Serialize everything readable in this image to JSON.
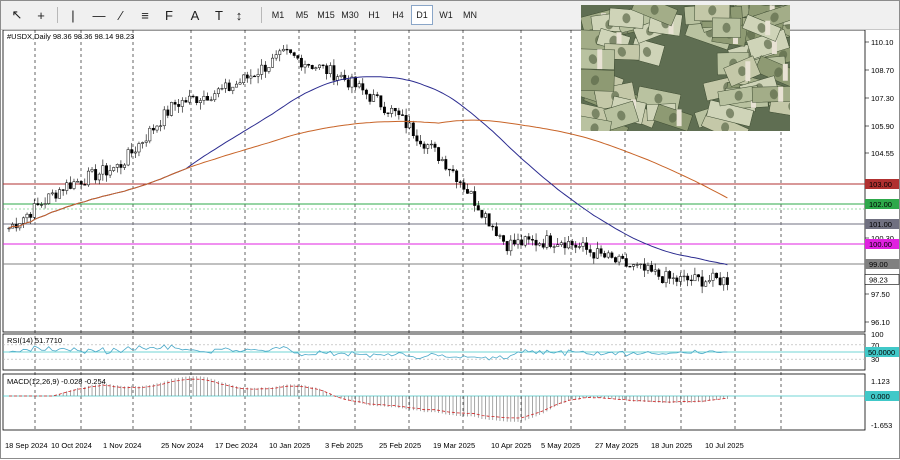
{
  "toolbar": {
    "tools": [
      {
        "name": "cursor-icon",
        "glyph": "↖"
      },
      {
        "name": "crosshair-icon",
        "glyph": "+"
      },
      {
        "name": "vertical-line-icon",
        "glyph": "|"
      },
      {
        "name": "horizontal-line-icon",
        "glyph": "—"
      },
      {
        "name": "trendline-icon",
        "glyph": "∕"
      },
      {
        "name": "equidistant-channel-icon",
        "glyph": "≡"
      },
      {
        "name": "fibonacci-icon",
        "glyph": "F"
      },
      {
        "name": "text-icon",
        "glyph": "A"
      },
      {
        "name": "text-label-icon",
        "glyph": "T"
      },
      {
        "name": "arrows-icon",
        "glyph": "↕"
      }
    ],
    "timeframes": [
      "M1",
      "M5",
      "M15",
      "M30",
      "H1",
      "H4",
      "D1",
      "W1",
      "MN"
    ],
    "active_timeframe": "D1"
  },
  "header": {
    "symbol_line": "#USDX,Daily  98.36 98.36 98.14 98.23"
  },
  "price_axis": {
    "ticks": [
      "110.10",
      "108.70",
      "107.30",
      "105.90",
      "104.55",
      "103.00",
      "102.00",
      "101.00",
      "100.30",
      "100.00",
      "99.00",
      "98.23",
      "97.50",
      "96.10"
    ]
  },
  "levels": [
    {
      "label": "103.00",
      "price": 103.0,
      "color": "#b03030"
    },
    {
      "label": "102.00",
      "price": 102.0,
      "color": "#2ea84a"
    },
    {
      "label": "101.00",
      "price": 101.0,
      "color": "#707080"
    },
    {
      "label": "100.00",
      "price": 100.0,
      "color": "#e020e0"
    },
    {
      "label": "99.00",
      "price": 99.0,
      "color": "#808080"
    }
  ],
  "current_price": "98.23",
  "rsi": {
    "label": "RSI(14) 51.7710",
    "ticks": [
      "100",
      "70",
      "50.0000",
      "30",
      "0"
    ]
  },
  "macd": {
    "label": "MACD(12,26,9) -0.028 -0.254",
    "ticks": [
      "1.123",
      "0.000",
      "-1.653"
    ]
  },
  "date_axis": [
    "18 Sep 2024",
    "10 Oct 2024",
    "1 Nov 2024",
    "25 Nov 2024",
    "17 Dec 2024",
    "10 Jan 2025",
    "3 Feb 2025",
    "25 Feb 2025",
    "19 Mar 2025",
    "10 Apr 2025",
    "5 May 2025",
    "27 May 2025",
    "18 Jun 2025",
    "10 Jul 2025"
  ],
  "colors": {
    "ma_fast": "#2c2c90",
    "ma_slow": "#c86428",
    "rsi_line": "#4aa8c8",
    "macd_signal": "#d02020",
    "level_cyan": "#40c8c8"
  },
  "chart_data": {
    "type": "candlestick",
    "symbol": "#USDX",
    "timeframe": "Daily",
    "last_ohlc": {
      "open": 98.36,
      "high": 98.36,
      "low": 98.14,
      "close": 98.23
    },
    "approx_close_path": [
      {
        "x": "18 Sep 2024",
        "y": 100.8
      },
      {
        "x": "10 Oct 2024",
        "y": 102.9
      },
      {
        "x": "1 Nov 2024",
        "y": 103.9
      },
      {
        "x": "25 Nov 2024",
        "y": 107.0
      },
      {
        "x": "17 Dec 2024",
        "y": 107.8
      },
      {
        "x": "10 Jan 2025",
        "y": 109.5
      },
      {
        "x": "3 Feb 2025",
        "y": 108.4
      },
      {
        "x": "25 Feb 2025",
        "y": 106.5
      },
      {
        "x": "19 Mar 2025",
        "y": 103.8
      },
      {
        "x": "10 Apr 2025",
        "y": 100.0
      },
      {
        "x": "5 May 2025",
        "y": 100.2
      },
      {
        "x": "27 May 2025",
        "y": 99.1
      },
      {
        "x": "18 Jun 2025",
        "y": 98.2
      },
      {
        "x": "10 Jul 2025",
        "y": 98.2
      }
    ],
    "ylim": [
      96.1,
      110.1
    ]
  }
}
